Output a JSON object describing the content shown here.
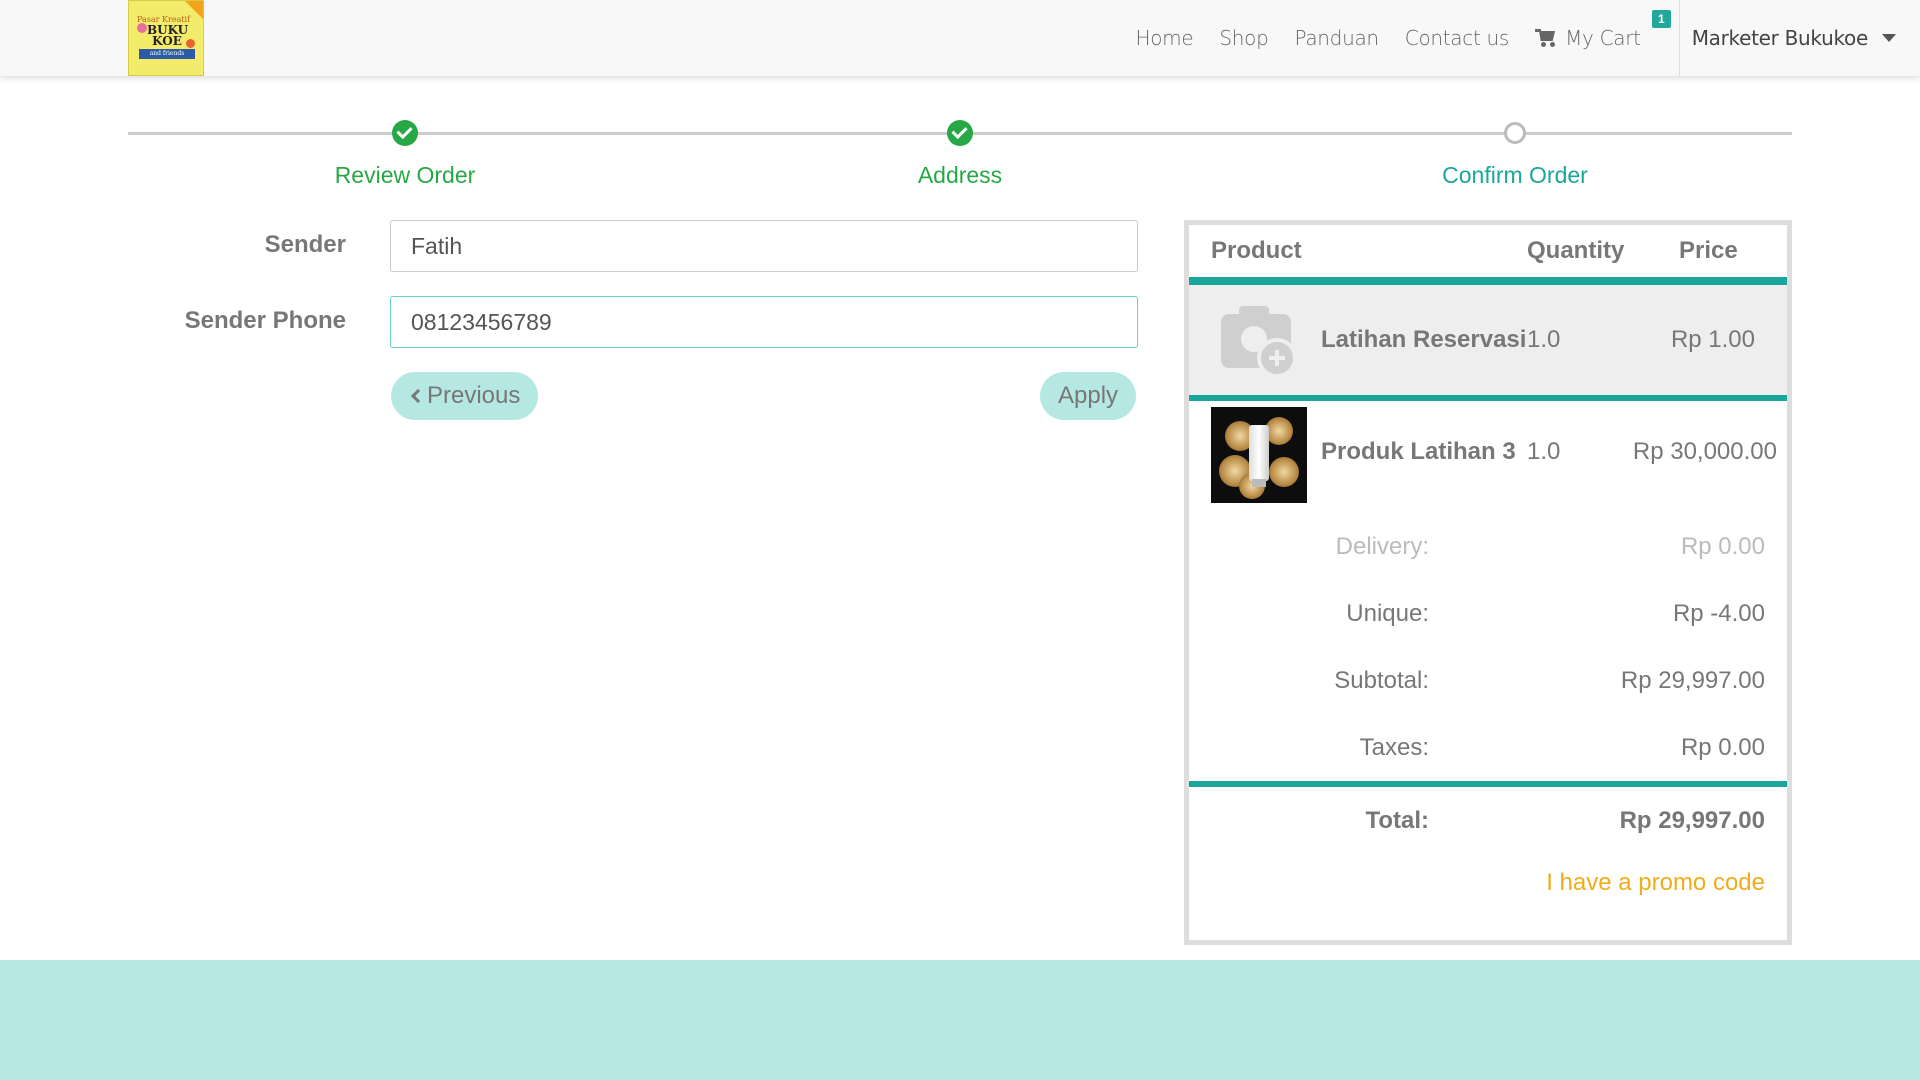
{
  "nav": {
    "logo_text_top": "Pasar Kreatif",
    "logo_text_main": "BUKU KOE",
    "logo_text_ribbon": "and friends",
    "links": [
      "Home",
      "Shop",
      "Panduan",
      "Contact us"
    ],
    "cart_label": "My Cart",
    "cart_count": "1",
    "user_name": "Marketer Bukukoe"
  },
  "wizard": {
    "steps": [
      {
        "label": "Review Order",
        "state": "done"
      },
      {
        "label": "Address",
        "state": "done"
      },
      {
        "label": "Confirm Order",
        "state": "todo"
      }
    ]
  },
  "form": {
    "sender_label": "Sender",
    "sender_value": "Fatih",
    "phone_label": "Sender Phone",
    "phone_value": "08123456789",
    "previous_label": "Previous",
    "apply_label": "Apply"
  },
  "summary": {
    "headers": {
      "product": "Product",
      "quantity": "Quantity",
      "price": "Price"
    },
    "items": [
      {
        "name": "Latihan Reservasi",
        "qty": "1.0",
        "price": "Rp 1.00",
        "image": "camera-placeholder-icon"
      },
      {
        "name": "Produk Latihan 3",
        "qty": "1.0",
        "price": "Rp 30,000.00",
        "image": "product-photo"
      }
    ],
    "delivery_label": "Delivery:",
    "delivery_value": "Rp 0.00",
    "unique_label": "Unique:",
    "unique_value": "Rp -4.00",
    "subtotal_label": "Subtotal:",
    "subtotal_value": "Rp 29,997.00",
    "taxes_label": "Taxes:",
    "taxes_value": "Rp 0.00",
    "total_label": "Total:",
    "total_value": "Rp 29,997.00",
    "promo_label": "I have a promo code"
  },
  "colors": {
    "accent": "#1aa69a",
    "success": "#28a745",
    "promo": "#f0ad1a",
    "footer": "#b8e8e4"
  }
}
